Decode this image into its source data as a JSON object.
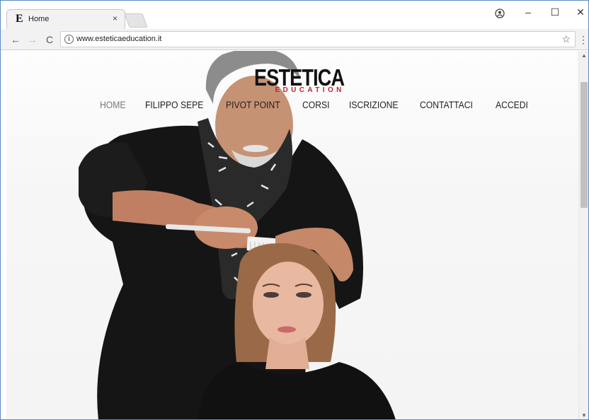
{
  "browser": {
    "tab_title": "Home",
    "tab_favicon": "E",
    "tab_close": "×",
    "url": "www.esteticaeducation.it",
    "window_controls": {
      "minimize": "–",
      "maximize": "☐",
      "close": "✕"
    },
    "nav": {
      "back": "←",
      "forward": "→",
      "reload": "C"
    },
    "info_icon": "i",
    "star_icon": "☆",
    "menu_icon": "⋮",
    "scroll_up": "▲",
    "scroll_down": "▼"
  },
  "site": {
    "logo_main": "ESTETICA",
    "logo_sub": "EDUCATION",
    "nav_items": [
      {
        "label": "HOME",
        "active": true
      },
      {
        "label": "FILIPPO SEPE",
        "active": false
      },
      {
        "label": "PIVOT POINT",
        "active": false
      },
      {
        "label": "CORSI",
        "active": false
      },
      {
        "label": "ISCRIZIONE",
        "active": false
      },
      {
        "label": "CONTATTACI",
        "active": false
      },
      {
        "label": "ACCEDI",
        "active": false
      }
    ]
  },
  "colors": {
    "logo_accent": "#c6202e",
    "window_border": "#5a8ac6",
    "jacket": "#151515",
    "model_hair": "#9a6a48"
  }
}
